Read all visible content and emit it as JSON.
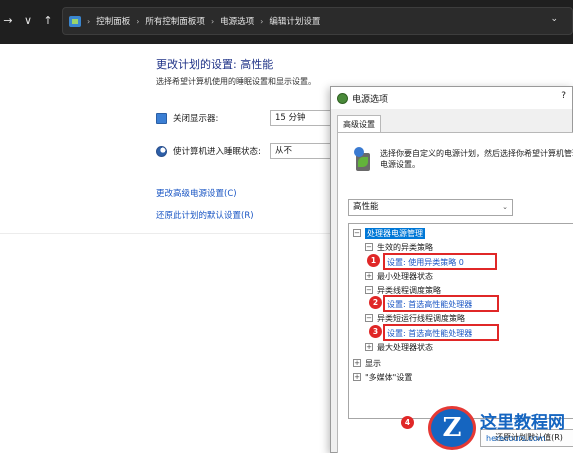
{
  "nav": {
    "back": "→",
    "dropdown": "∨",
    "up": "↑"
  },
  "breadcrumbs": [
    "控制面板",
    "所有控制面板项",
    "电源选项",
    "编辑计划设置"
  ],
  "page": {
    "title": "更改计划的设置: 高性能",
    "subtitle": "选择希望计算机使用的睡眠设置和显示设置。",
    "display_label": "关闭显示器:",
    "display_value": "15 分钟",
    "sleep_label": "使计算机进入睡眠状态:",
    "sleep_value": "从不",
    "link_advanced": "更改高级电源设置(C)",
    "link_restore": "还原此计划的默认设置(R)"
  },
  "dialog": {
    "title": "电源选项",
    "help": "?",
    "tab": "高级设置",
    "description": "选择你要自定义的电源计划，然后选择你希望计算机管理电源设置。",
    "plan": "高性能",
    "tree": {
      "root": "处理器电源管理",
      "n1": "生效的异类策略",
      "n1_setting": "设置: 使用异类策略 0",
      "n2": "最小处理器状态",
      "n3": "异类线程调度策略",
      "n3_setting": "设置: 首选高性能处理器",
      "n4": "异类短运行线程调度策略",
      "n4_setting": "设置: 首选高性能处理器",
      "n5": "最大处理器状态",
      "n6": "显示",
      "n7": "\"多媒体\"设置"
    },
    "restore_button": "还原计划默认值(R)"
  },
  "badges": [
    "1",
    "2",
    "3",
    "4"
  ],
  "watermark": {
    "logo_letter": "Z",
    "title": "这里教程网",
    "url": "herecours.com"
  },
  "colors": {
    "annotation_red": "#e02727",
    "link_blue": "#1a56c4",
    "selection": "#0078d7"
  }
}
